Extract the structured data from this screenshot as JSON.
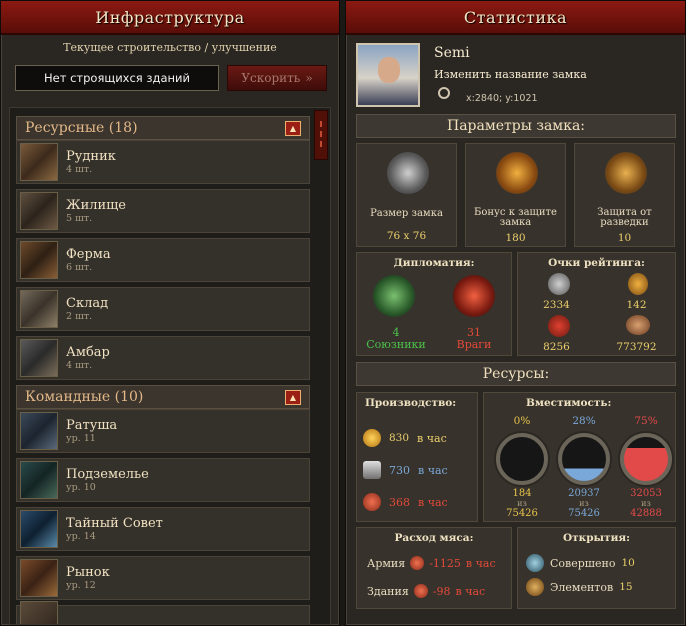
{
  "left": {
    "title": "Инфраструктура",
    "subtitle": "Текущее строительство / улучшение",
    "status": "Нет строящихся зданий",
    "speedup": "Ускорить",
    "categories": [
      {
        "label": "Ресурсные (18)"
      },
      {
        "label": "Командные (10)"
      }
    ],
    "items": [
      {
        "name": "Рудник",
        "count": "4 шт."
      },
      {
        "name": "Жилище",
        "count": "5 шт."
      },
      {
        "name": "Ферма",
        "count": "6 шт."
      },
      {
        "name": "Склад",
        "count": "2 шт."
      },
      {
        "name": "Амбар",
        "count": "4 шт."
      },
      {
        "name": "Ратуша",
        "count": "ур. 11"
      },
      {
        "name": "Подземелье",
        "count": "ур. 10"
      },
      {
        "name": "Тайный Совет",
        "count": "ур. 14"
      },
      {
        "name": "Рынок",
        "count": "ур. 12"
      }
    ]
  },
  "right": {
    "title": "Статистика",
    "player": "Semi",
    "rename": "Изменить название замка",
    "coords": "x:2840; y:1021",
    "params_title": "Параметры замка:",
    "params": [
      {
        "label": "Размер замка",
        "value": "76 x 76",
        "icon": "castle-icon"
      },
      {
        "label": "Бонус к защите замка",
        "value": "180",
        "icon": "shield-icon"
      },
      {
        "label": "Защита от разведки",
        "value": "10",
        "icon": "eagle-icon"
      }
    ],
    "diplomacy": {
      "title": "Дипломатия:",
      "allies_count": "4",
      "allies": "Союзники",
      "enemies_count": "31",
      "enemies": "Враги"
    },
    "rating": {
      "title": "Очки рейтинга:",
      "swords": "2334",
      "shield": "142",
      "banner": "8256",
      "hand": "773792"
    },
    "resources_title": "Ресурсы:",
    "production": {
      "title": "Производство:",
      "per_hour": "в час",
      "gold": "830",
      "iron": "730",
      "meat": "368"
    },
    "capacity": {
      "title": "Вместимость:",
      "of": "из",
      "tanks": [
        {
          "percent": "0%",
          "value": "184",
          "max": "75426",
          "fill": 0,
          "color": "#e6c34d"
        },
        {
          "percent": "28%",
          "value": "20937",
          "max": "75426",
          "fill": 0.28,
          "color": "#7aa8d8"
        },
        {
          "percent": "75%",
          "value": "32053",
          "max": "42888",
          "fill": 0.75,
          "color": "#e24a4a"
        }
      ]
    },
    "meat_use": {
      "title": "Расход мяса:",
      "army": "Армия",
      "army_val": "-1125",
      "buildings": "Здания",
      "buildings_val": "-98",
      "per_hour": "в час"
    },
    "discoveries": {
      "title": "Открытия:",
      "done": "Совершено",
      "done_val": "10",
      "elements": "Элементов",
      "elements_val": "15"
    }
  }
}
